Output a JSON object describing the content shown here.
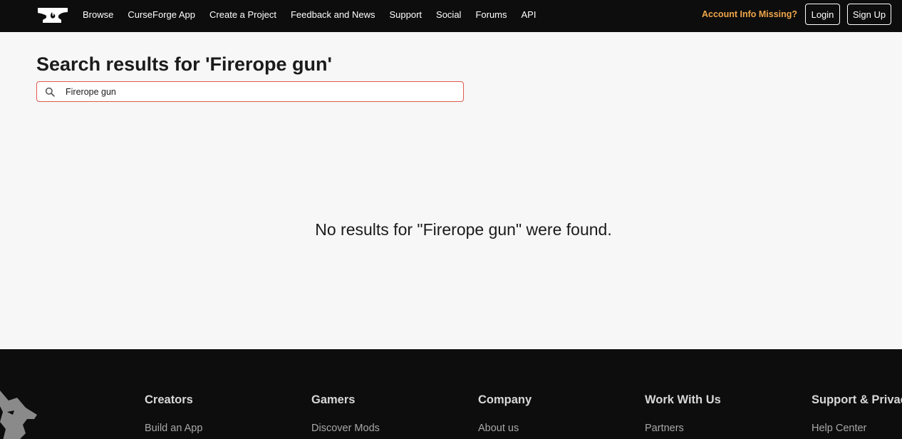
{
  "header": {
    "nav": [
      "Browse",
      "CurseForge App",
      "Create a Project",
      "Feedback and News",
      "Support",
      "Social",
      "Forums",
      "API"
    ],
    "account_notice": "Account Info Missing?",
    "login_label": "Login",
    "signup_label": "Sign Up"
  },
  "main": {
    "title": "Search results for 'Firerope gun'",
    "search_value": "Firerope gun",
    "no_results_text": "No results for \"Firerope gun\" were found."
  },
  "footer": {
    "columns": [
      {
        "heading": "Creators",
        "first_link": "Build an App"
      },
      {
        "heading": "Gamers",
        "first_link": "Discover Mods"
      },
      {
        "heading": "Company",
        "first_link": "About us"
      },
      {
        "heading": "Work With Us",
        "first_link": "Partners"
      },
      {
        "heading": "Support & Privacy",
        "first_link": "Help Center"
      }
    ]
  },
  "colors": {
    "header_bg": "#0d0d0d",
    "page_bg": "#f7f7f7",
    "account_notice": "#f0a64a",
    "search_border": "#e05a4f"
  },
  "icons": [
    "anvil-logo-icon",
    "search-icon",
    "wolf-logo-icon"
  ]
}
